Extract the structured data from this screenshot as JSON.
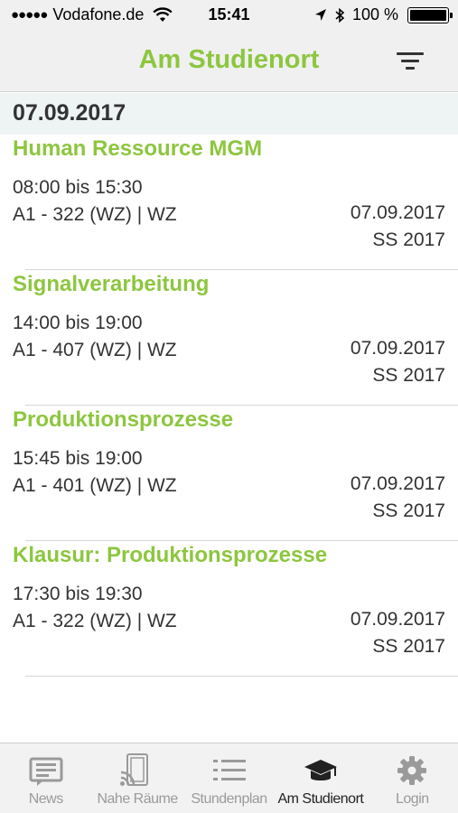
{
  "status_bar": {
    "carrier": "Vodafone.de",
    "time": "15:41",
    "battery": "100 %"
  },
  "nav": {
    "title": "Am Studienort",
    "filter_icon": "filter-icon"
  },
  "section": {
    "date": "07.09.2017"
  },
  "entries": [
    {
      "title": "Human Ressource MGM",
      "time": "08:00 bis 15:30",
      "room": "A1 - 322 (WZ) | WZ",
      "date": "07.09.2017",
      "semester": "SS 2017"
    },
    {
      "title": "Signalverarbeitung",
      "time": "14:00 bis 19:00",
      "room": "A1 - 407 (WZ) | WZ",
      "date": "07.09.2017",
      "semester": "SS 2017"
    },
    {
      "title": "Produktionsprozesse",
      "time": "15:45 bis 19:00",
      "room": "A1 - 401 (WZ) | WZ",
      "date": "07.09.2017",
      "semester": "SS 2017"
    },
    {
      "title": "Klausur: Produktionsprozesse",
      "time": "17:30 bis 19:30",
      "room": "A1 - 322 (WZ) | WZ",
      "date": "07.09.2017",
      "semester": "SS 2017"
    }
  ],
  "tabs": [
    {
      "label": "News",
      "icon": "news-icon",
      "active": false
    },
    {
      "label": "Nahe Räume",
      "icon": "nearby-rooms-icon",
      "active": false
    },
    {
      "label": "Stundenplan",
      "icon": "schedule-list-icon",
      "active": false
    },
    {
      "label": "Am Studienort",
      "icon": "graduation-cap-icon",
      "active": true
    },
    {
      "label": "Login",
      "icon": "gear-icon",
      "active": false
    }
  ],
  "colors": {
    "accent": "#8dc63f",
    "text": "#333333",
    "section_bg": "#eef3f4",
    "bar_bg": "#f0f0f0",
    "tab_inactive": "#9a9a9a"
  }
}
